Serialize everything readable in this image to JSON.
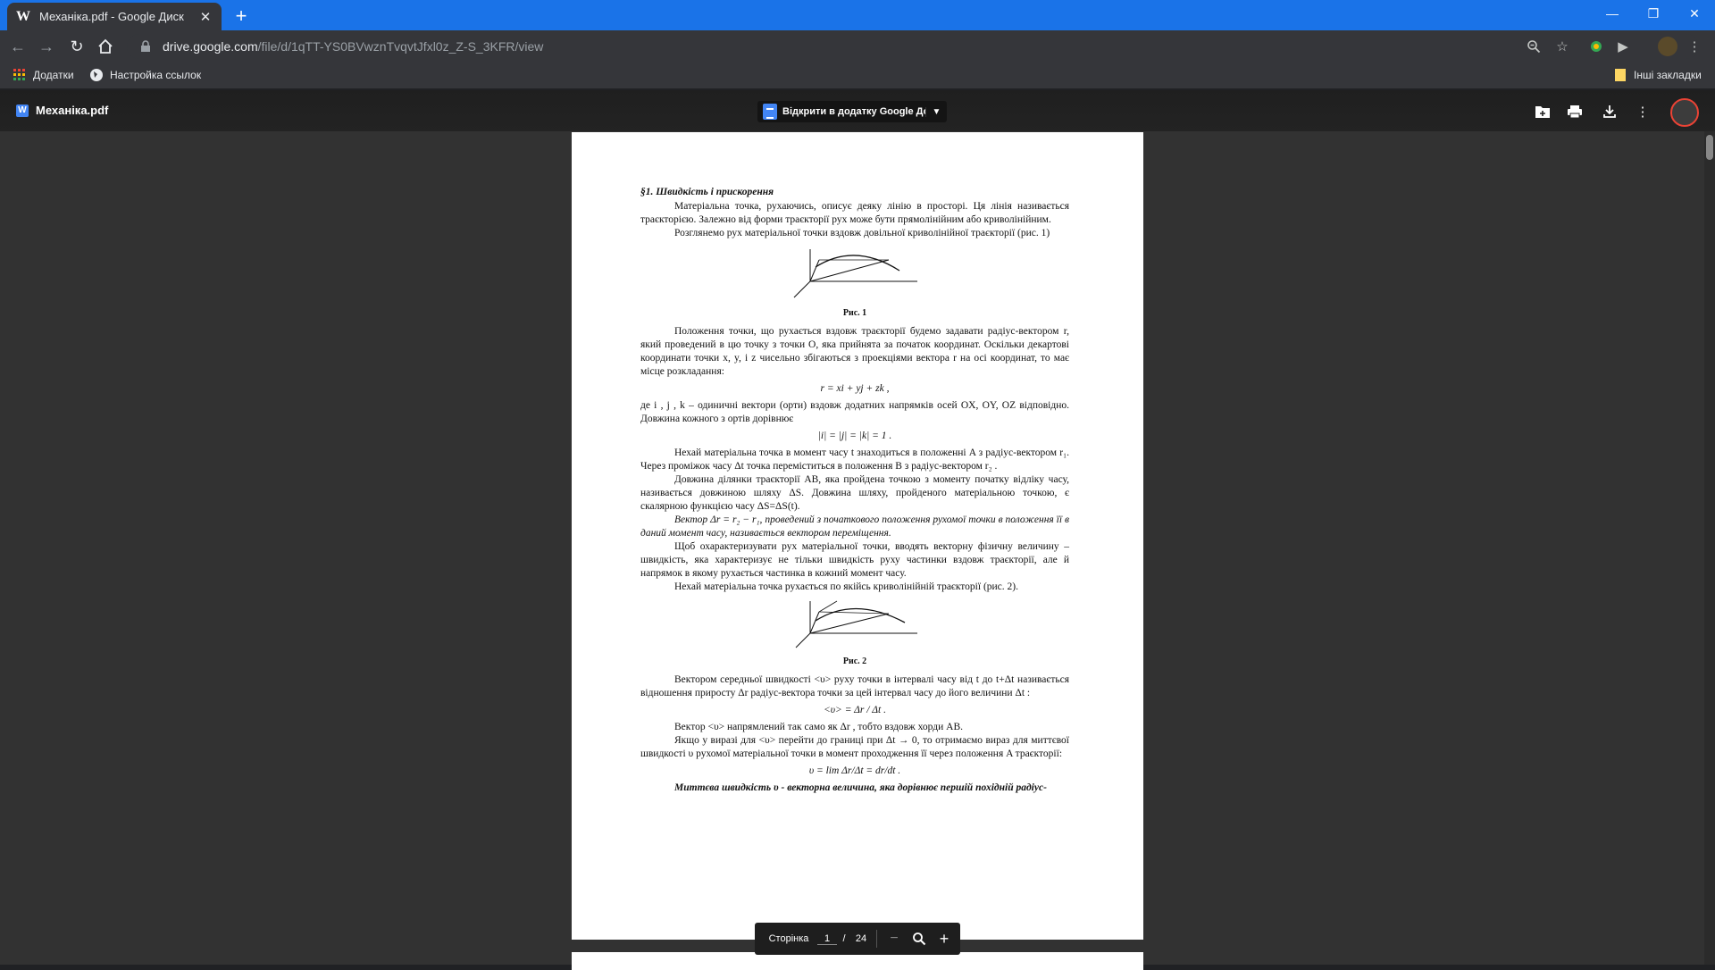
{
  "browser": {
    "tab_title": "Механіка.pdf - Google Диск",
    "url_host": "drive.google.com",
    "url_path": "/file/d/1qTT-YS0BVwznTvqvtJfxl0z_Z-S_3KFR/view",
    "bookmarks": [
      {
        "label": "Додатки"
      },
      {
        "label": "Настройка ссылок"
      }
    ],
    "other_bookmarks": "Інші закладки"
  },
  "viewer": {
    "doc_name": "Механіка.pdf",
    "open_with": "Відкрити в додатку Google До..."
  },
  "document": {
    "heading": "§1. Швидкість і прискорення",
    "p1": "Матеріальна точка, рухаючись, описує деяку лінію в просторі. Ця лінія називається траєкторією. Залежно від форми траєкторії рух може бути прямолінійним або криволінійним.",
    "p2": "Розглянемо рух матеріальної точки вздовж довільної криволінійної траєкторії (рис. 1)",
    "fig1_caption": "Рис. 1",
    "p3": "Положення точки, що рухається вздовж траєкторії будемо задавати радіус-вектором r, який проведений в цю точку з точки O, яка прийнята за початок координат. Оскільки декартові координати точки x, y, і z чисельно збігаються з проекціями вектора r на осі координат, то має місце розкладання:",
    "f1": "r = xi + yj + zk ,",
    "p4": "де i , j , k – одиничні вектори (орти) вздовж додатних напрямків осей OX, OY, OZ відповідно. Довжина кожного з ортів дорівнює",
    "f2": "|i| = |j| = |k| = 1 .",
    "p5": "Нехай матеріальна точка в момент часу t знаходиться в положенні A з радіус-вектором r₁. Через проміжок часу Δt точка переміститься в положення B з радіус-вектором r₂ .",
    "p6": "Довжина ділянки траєкторії AB, яка пройдена точкою з моменту початку відліку часу, називається довжиною шляху ΔS. Довжина шляху, пройденого матеріальною точкою, є скалярною функцією часу ΔS=ΔS(t).",
    "p7": "Вектор Δr = r₂ − r₁, проведений з початкового положення рухомої точки в положення її в даний момент часу, називається вектором переміщення.",
    "p8": "Щоб охарактеризувати рух матеріальної точки, вводять векторну фізичну величину – швидкість, яка характеризує не тільки швидкість руху частинки вздовж траєкторії, але й напрямок в якому рухається частинка в кожний момент часу.",
    "p9": "Нехай матеріальна точка рухається по якійсь криволінійній траєкторії (рис. 2).",
    "fig2_caption": "Рис. 2",
    "p10": "Вектором середньої швидкості <υ> руху точки в інтервалі часу від t до t+Δt називається відношення приросту Δr радіус-вектора точки за цей інтервал часу до його величини Δt :",
    "f3": "<υ> = Δr / Δt .",
    "p11": "Вектор <υ> напрямлений так само як Δr , тобто вздовж хорди AB.",
    "p12": "Якщо у виразі для <υ> перейти до границі при Δt → 0, то отримаємо вираз для миттєвої швидкості υ рухомої матеріальної точки в момент проходження її через положення A траєкторії:",
    "f4": "υ = lim Δr/Δt = dr/dt .",
    "p13": "Миттєва швидкість υ - векторна величина, яка дорівнює першій похідній радіус-"
  },
  "pagenav": {
    "label": "Сторінка",
    "current": "1",
    "sep": "/",
    "total": "24"
  }
}
